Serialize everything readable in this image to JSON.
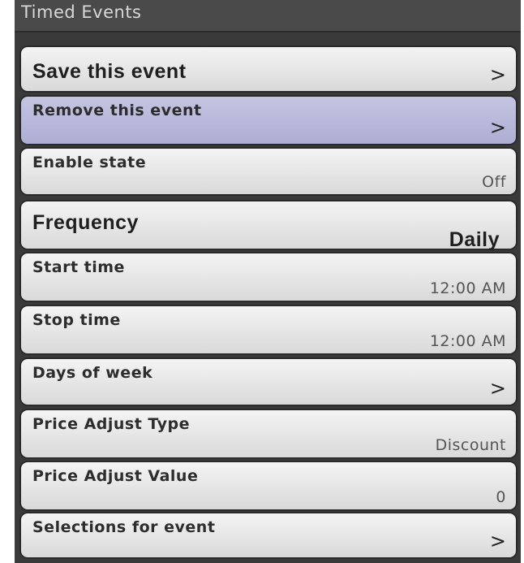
{
  "window": {
    "title": "Timed Events"
  },
  "rows": [
    {
      "label": "Save this event",
      "chevron": ">"
    },
    {
      "label": "Remove this event",
      "chevron": ">"
    },
    {
      "label": "Enable state",
      "value": "Off"
    },
    {
      "label": "Frequency",
      "value": "Daily"
    },
    {
      "label": "Start time",
      "value": "12:00 AM"
    },
    {
      "label": "Stop time",
      "value": "12:00 AM"
    },
    {
      "label": "Days of week",
      "chevron": ">"
    },
    {
      "label": "Price Adjust Type",
      "value": "Discount"
    },
    {
      "label": "Price Adjust Value",
      "value": "0"
    },
    {
      "label": "Selections for event",
      "chevron": ">"
    }
  ],
  "colors": {
    "panel_bg": "#3a3a3a",
    "row_bg": "#e6e6e6",
    "selected_row_bg": "#b8b8dc",
    "title_text": "#d8d8d8"
  }
}
